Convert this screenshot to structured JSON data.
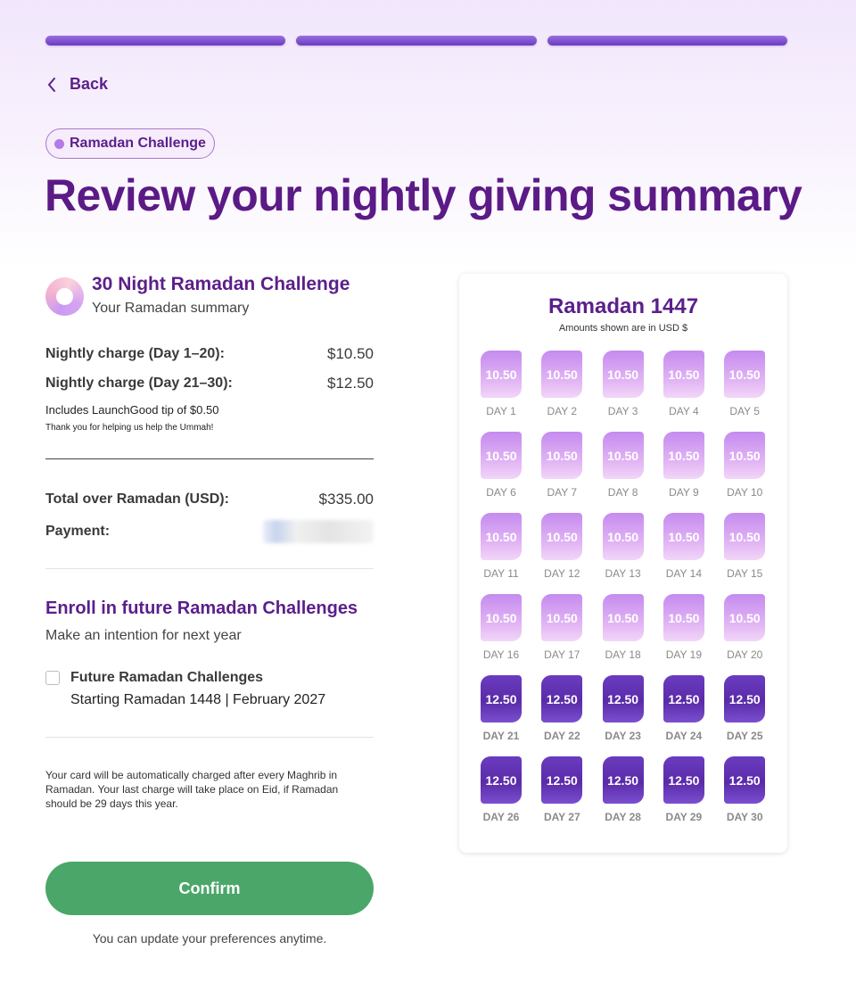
{
  "back_label": "Back",
  "badge_label": "Ramadan Challenge",
  "page_title": "Review your nightly giving summary",
  "summary": {
    "title": "30 Night Ramadan Challenge",
    "subtitle": "Your Ramadan summary",
    "nightly_1_label": "Nightly charge (Day 1–20):",
    "nightly_1_value": "$10.50",
    "nightly_2_label": "Nightly charge (Day 21–30):",
    "nightly_2_value": "$12.50",
    "tip_note": "Includes LaunchGood tip of $0.50",
    "thanks_note": "Thank you for helping us help the Ummah!",
    "total_label": "Total over Ramadan (USD):",
    "total_value": "$335.00",
    "payment_label": "Payment:"
  },
  "enroll": {
    "title": "Enroll in future Ramadan Challenges",
    "subtitle": "Make an intention for next year",
    "option_title": "Future Ramadan Challenges",
    "option_sub": "Starting Ramadan 1448 | February 2027",
    "checked": false
  },
  "notice": "Your card will be automatically charged after every Maghrib in Ramadan. Your last charge will take place on Eid, if Ramadan should be 29 days this year.",
  "confirm_label": "Confirm",
  "footnote": "You can update your preferences anytime.",
  "calendar": {
    "title": "Ramadan 1447",
    "units_note": "Amounts shown are in USD $",
    "days": [
      {
        "label": "DAY 1",
        "amount": "10.50"
      },
      {
        "label": "DAY 2",
        "amount": "10.50"
      },
      {
        "label": "DAY 3",
        "amount": "10.50"
      },
      {
        "label": "DAY 4",
        "amount": "10.50"
      },
      {
        "label": "DAY 5",
        "amount": "10.50"
      },
      {
        "label": "DAY 6",
        "amount": "10.50"
      },
      {
        "label": "DAY 7",
        "amount": "10.50"
      },
      {
        "label": "DAY 8",
        "amount": "10.50"
      },
      {
        "label": "DAY 9",
        "amount": "10.50"
      },
      {
        "label": "DAY 10",
        "amount": "10.50"
      },
      {
        "label": "DAY 11",
        "amount": "10.50"
      },
      {
        "label": "DAY 12",
        "amount": "10.50"
      },
      {
        "label": "DAY 13",
        "amount": "10.50"
      },
      {
        "label": "DAY 14",
        "amount": "10.50"
      },
      {
        "label": "DAY 15",
        "amount": "10.50"
      },
      {
        "label": "DAY 16",
        "amount": "10.50"
      },
      {
        "label": "DAY 17",
        "amount": "10.50"
      },
      {
        "label": "DAY 18",
        "amount": "10.50"
      },
      {
        "label": "DAY 19",
        "amount": "10.50"
      },
      {
        "label": "DAY 20",
        "amount": "10.50"
      },
      {
        "label": "DAY 21",
        "amount": "12.50"
      },
      {
        "label": "DAY 22",
        "amount": "12.50"
      },
      {
        "label": "DAY 23",
        "amount": "12.50"
      },
      {
        "label": "DAY 24",
        "amount": "12.50"
      },
      {
        "label": "DAY 25",
        "amount": "12.50"
      },
      {
        "label": "DAY 26",
        "amount": "12.50"
      },
      {
        "label": "DAY 27",
        "amount": "12.50"
      },
      {
        "label": "DAY 28",
        "amount": "12.50"
      },
      {
        "label": "DAY 29",
        "amount": "12.50"
      },
      {
        "label": "DAY 30",
        "amount": "12.50"
      }
    ]
  },
  "colors": {
    "brand_purple": "#5b1f8a",
    "confirm_green": "#4ba66a",
    "tile_light": "#d7a4f2",
    "tile_dark": "#5f30b0"
  },
  "progress": {
    "steps_total": 3,
    "steps_complete": 3
  }
}
